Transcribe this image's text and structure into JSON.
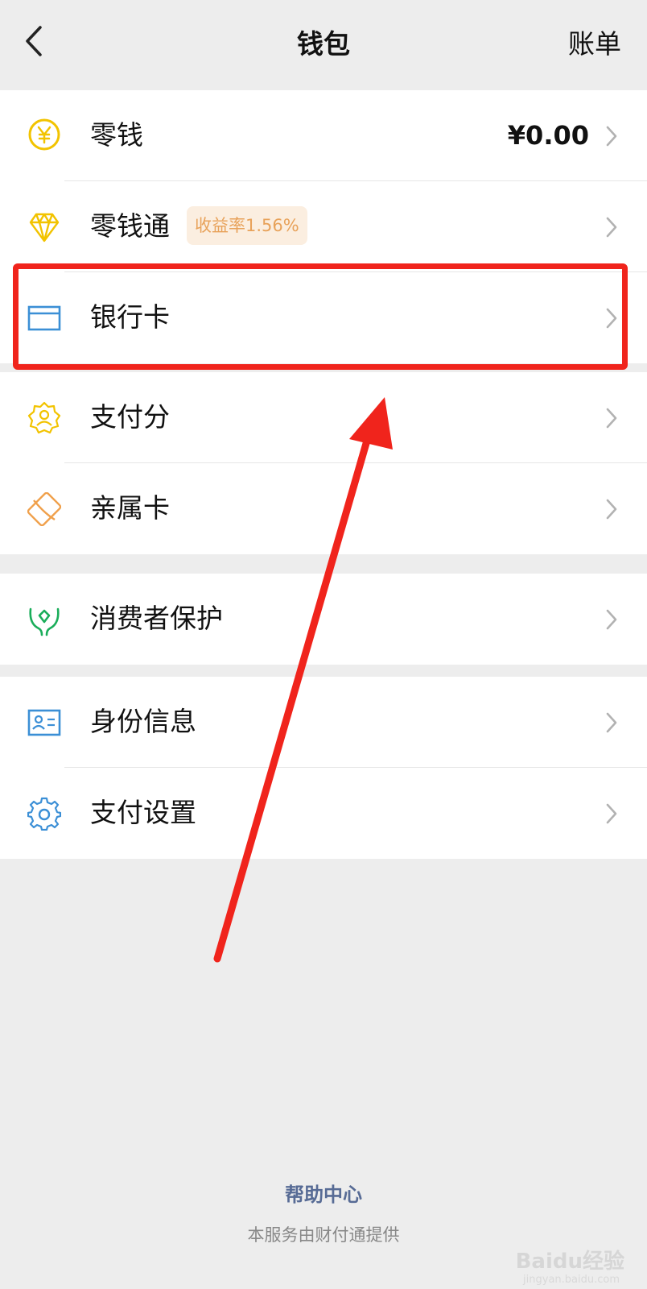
{
  "header": {
    "title": "钱包",
    "right_action": "账单"
  },
  "groups": [
    {
      "items": [
        {
          "label": "零钱",
          "value": "¥0.00",
          "icon": "yuan-coin-icon"
        },
        {
          "label": "零钱通",
          "badge": "收益率1.56%",
          "icon": "diamond-icon"
        },
        {
          "label": "银行卡",
          "icon": "bank-card-icon"
        }
      ]
    },
    {
      "items": [
        {
          "label": "支付分",
          "icon": "pay-score-icon"
        },
        {
          "label": "亲属卡",
          "icon": "family-card-icon"
        }
      ]
    },
    {
      "items": [
        {
          "label": "消费者保护",
          "icon": "consumer-protection-icon"
        }
      ]
    },
    {
      "items": [
        {
          "label": "身份信息",
          "icon": "id-card-icon"
        },
        {
          "label": "支付设置",
          "icon": "settings-gear-icon"
        }
      ]
    }
  ],
  "footer": {
    "help_link": "帮助中心",
    "provider_note": "本服务由财付通提供"
  },
  "watermark": {
    "brand": "Baidu经验",
    "domain": "jingyan.baidu.com"
  },
  "annotation": {
    "highlight_target": "银行卡",
    "color": "#f0241c"
  },
  "colors": {
    "background": "#ededed",
    "link": "#576b95",
    "badge_text": "#e8a25a",
    "badge_bg": "#fbeee0"
  }
}
